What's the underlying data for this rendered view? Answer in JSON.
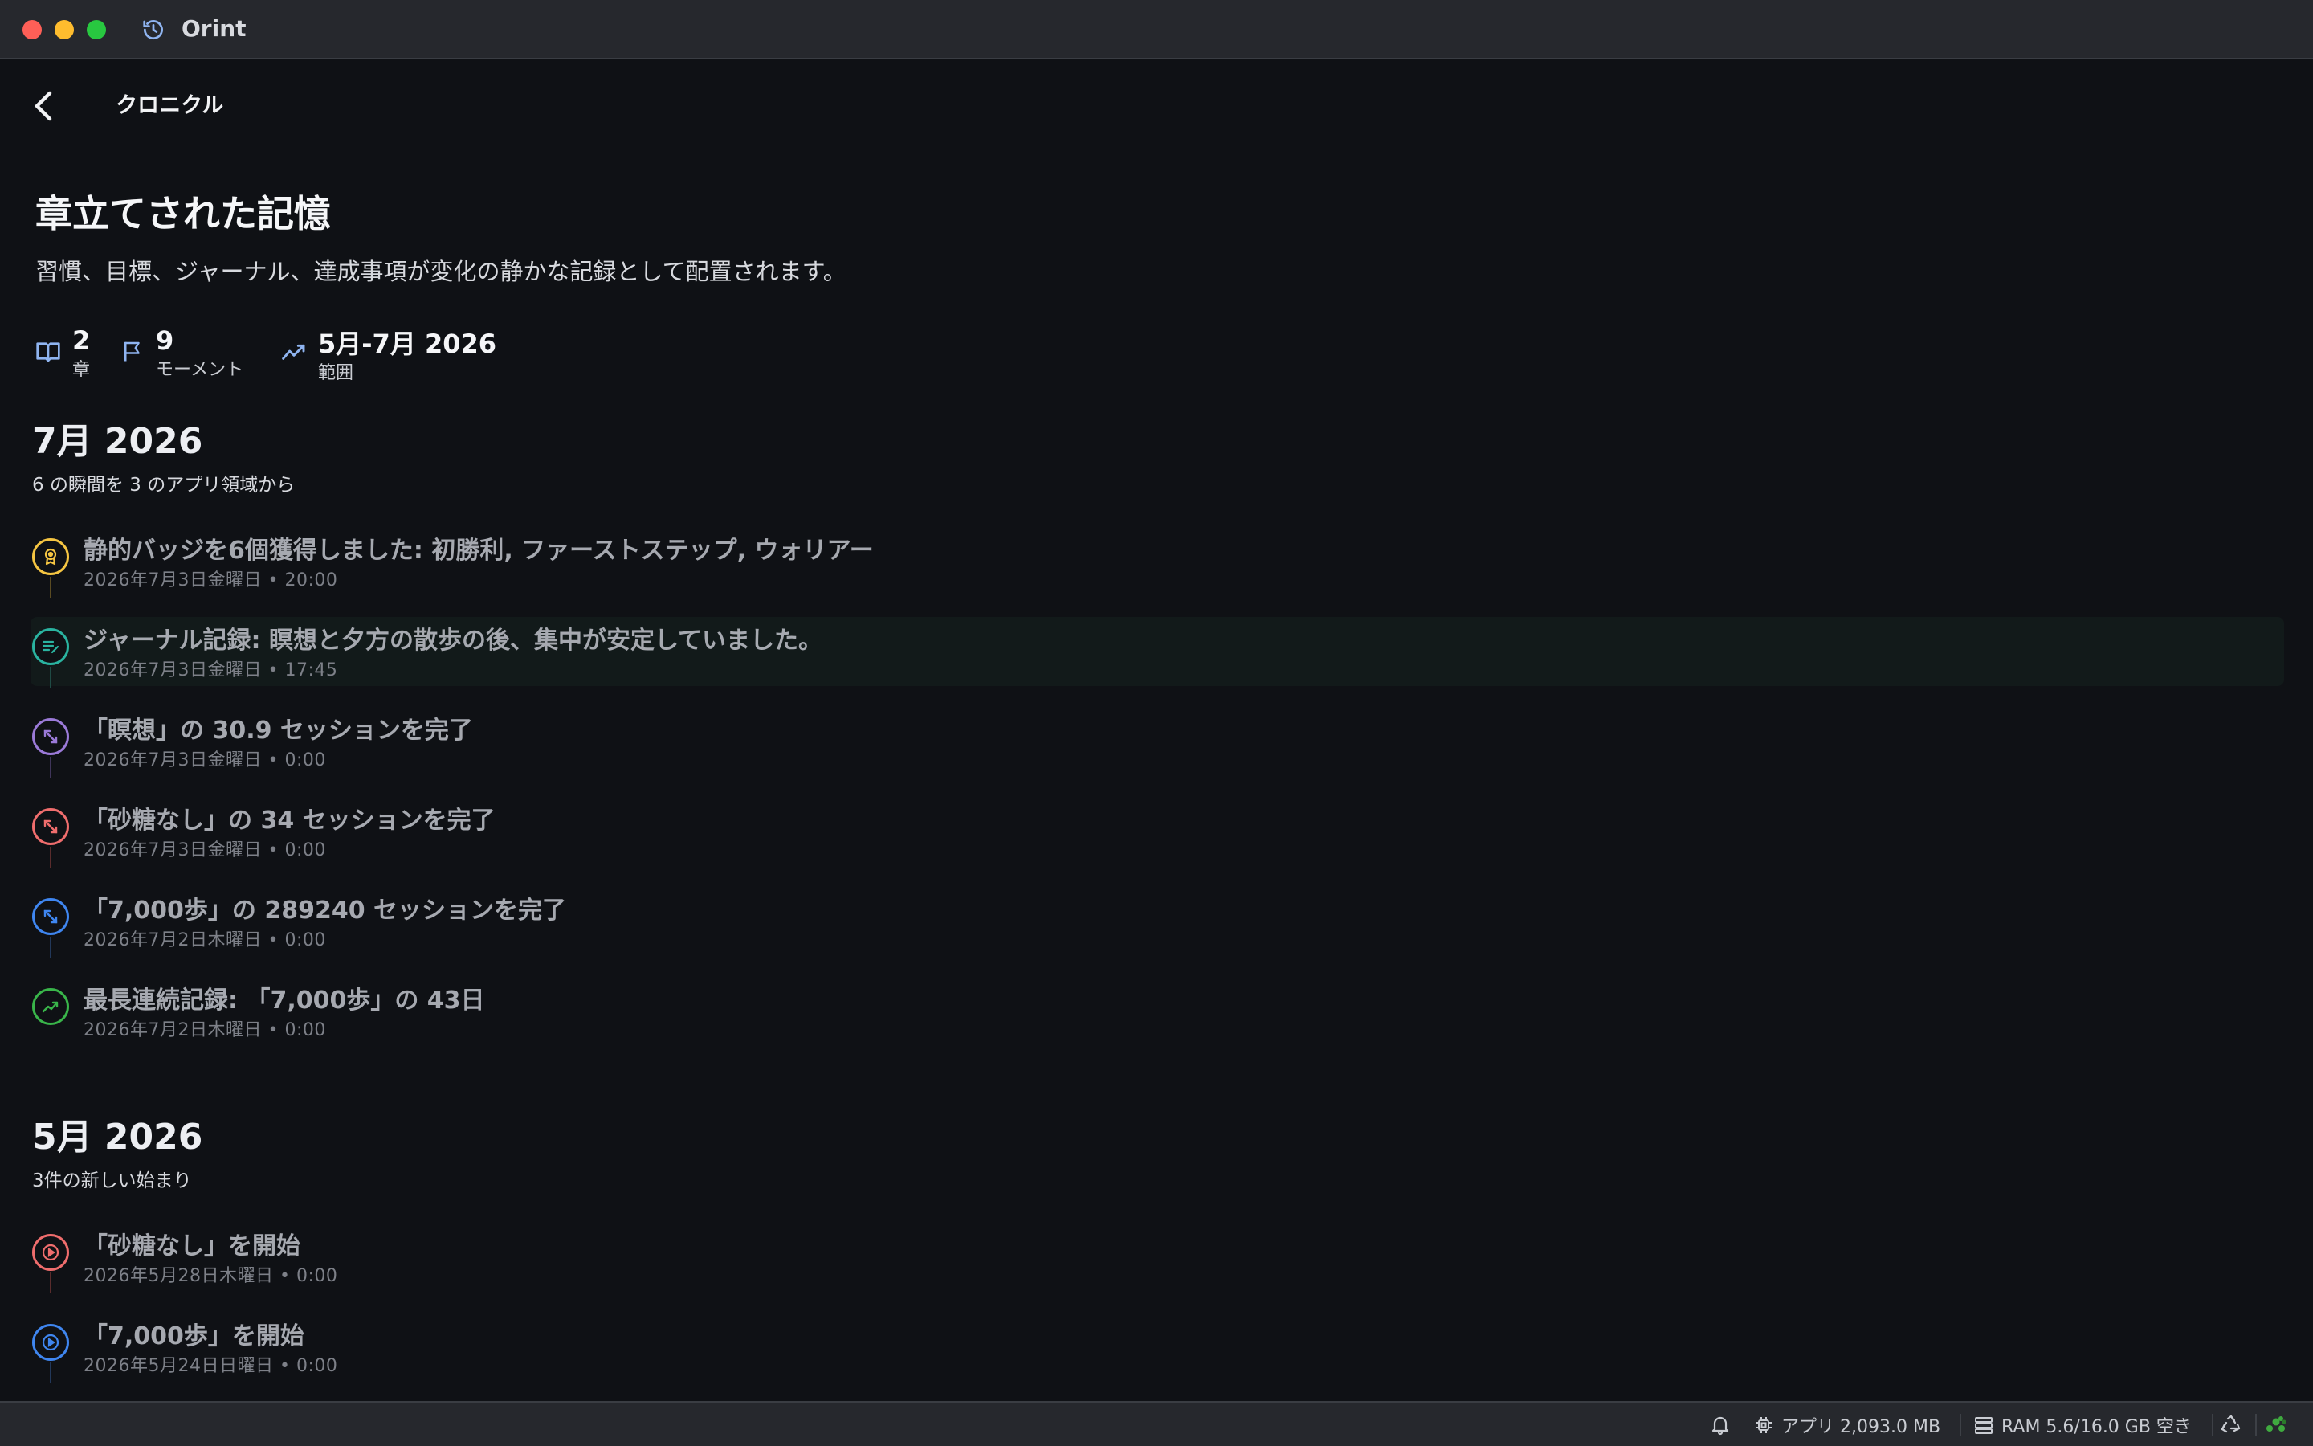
{
  "app": {
    "title": "Orint"
  },
  "header": {
    "title": "クロニクル"
  },
  "hero": {
    "title": "章立てされた記憶",
    "subtitle": "習慣、目標、ジャーナル、達成事項が変化の静かな記録として配置されます。"
  },
  "stats": [
    {
      "icon": "book-icon",
      "value": "2",
      "label": "章"
    },
    {
      "icon": "flag-icon",
      "value": "9",
      "label": "モーメント"
    },
    {
      "icon": "trend-icon",
      "value": "5月-7月 2026",
      "label": "範囲"
    }
  ],
  "sections": [
    {
      "title": "7月 2026",
      "subtitle": "6 の瞬間を 3 のアプリ領域から",
      "events": [
        {
          "icon": "badge-icon",
          "color": "#f5c542",
          "title": "静的バッジを6個獲得しました: 初勝利, ファーストステップ, ウォリアー",
          "time": "2026年7月3日金曜日 • 20:00"
        },
        {
          "icon": "journal-icon",
          "color": "#2ab3a0",
          "title": "ジャーナル記録: 瞑想と夕方の散歩の後、集中が安定していました。",
          "time": "2026年7月3日金曜日 • 17:45"
        },
        {
          "icon": "expand-icon",
          "color": "#9b7ad8",
          "title": "「瞑想」の 30.9 セッションを完了",
          "time": "2026年7月3日金曜日 • 0:00"
        },
        {
          "icon": "expand-icon",
          "color": "#ef6d6d",
          "title": "「砂糖なし」の 34 セッションを完了",
          "time": "2026年7月3日金曜日 • 0:00"
        },
        {
          "icon": "expand-icon",
          "color": "#3f86f0",
          "title": "「7,000歩」の 289240 セッションを完了",
          "time": "2026年7月2日木曜日 • 0:00"
        },
        {
          "icon": "trend-up-icon",
          "color": "#39b54a",
          "title": "最長連続記録: 「7,000歩」の 43日",
          "time": "2026年7月2日木曜日 • 0:00"
        }
      ]
    },
    {
      "title": "5月 2026",
      "subtitle": "3件の新しい始まり",
      "events": [
        {
          "icon": "play-circle-icon",
          "color": "#ef6d6d",
          "title": "「砂糖なし」を開始",
          "time": "2026年5月28日木曜日 • 0:00"
        },
        {
          "icon": "play-circle-icon",
          "color": "#3f86f0",
          "title": "「7,000歩」を開始",
          "time": "2026年5月24日日曜日 • 0:00"
        }
      ]
    }
  ],
  "statusbar": {
    "app_memory": "アプリ 2,093.0 MB",
    "ram": "RAM 5.6/16.0 GB 空き"
  }
}
